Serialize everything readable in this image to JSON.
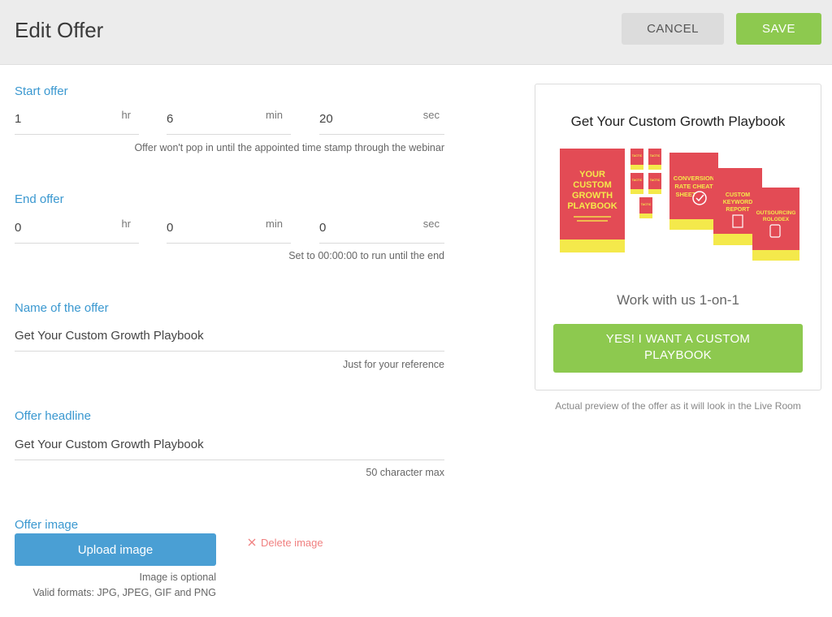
{
  "header": {
    "title": "Edit Offer",
    "cancel_label": "CANCEL",
    "save_label": "SAVE"
  },
  "start_offer": {
    "label": "Start offer",
    "hr": "1",
    "min": "6",
    "sec": "20",
    "hint": "Offer won't pop in until the appointed time stamp through the webinar"
  },
  "end_offer": {
    "label": "End offer",
    "hr": "0",
    "min": "0",
    "sec": "0",
    "hint": "Set to 00:00:00 to run until the end"
  },
  "units": {
    "hr": "hr",
    "min": "min",
    "sec": "sec"
  },
  "name": {
    "label": "Name of the offer",
    "value": "Get Your Custom Growth Playbook",
    "hint": "Just for your reference"
  },
  "headline": {
    "label": "Offer headline",
    "value": "Get Your Custom Growth Playbook",
    "hint": "50 character max"
  },
  "image": {
    "label": "Offer image",
    "upload_label": "Upload image",
    "delete_label": "Delete image",
    "hint_optional": "Image is optional",
    "hint_formats": "Valid formats: JPG, JPEG, GIF and PNG"
  },
  "preview": {
    "headline": "Get Your Custom Growth Playbook",
    "subtext": "Work with us 1-on-1",
    "cta": "YES! I WANT A CUSTOM PLAYBOOK",
    "caption": "Actual preview of the offer as it will look in the Live Room",
    "book_main": [
      "YOUR",
      "CUSTOM",
      "GROWTH",
      "PLAYBOOK"
    ],
    "book_conversion": [
      "CONVERSION",
      "RATE CHEAT",
      "SHEET"
    ],
    "book_keyword": [
      "CUSTOM",
      "KEYWORD",
      "REPORT"
    ],
    "book_rolodex": [
      "OUTSOURCING",
      "ROLODEX"
    ],
    "tactic_label": "TACTIC"
  },
  "colors": {
    "accent_blue": "#3a98d0",
    "green": "#8dc94f",
    "book_red": "#e34b55",
    "book_yellow": "#f4e94b"
  }
}
